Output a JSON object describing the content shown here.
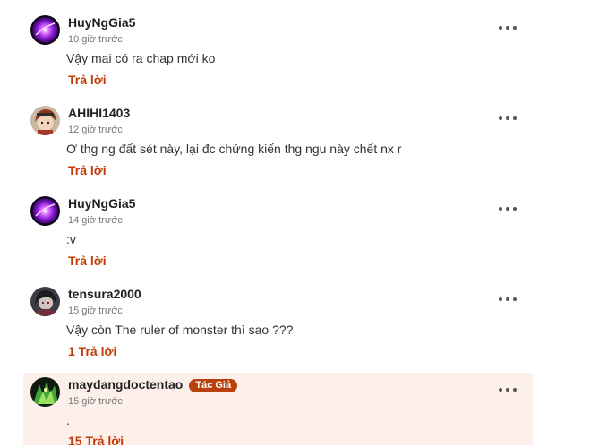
{
  "comments": [
    {
      "username": "HuyNgGia5",
      "time": "10 giờ trước",
      "content": "Vậy mai có ra chap mới ko",
      "reply_label": "Trả lời",
      "avatar": "purple-orb-avatar"
    },
    {
      "username": "AHIHI1403",
      "time": "12 giờ trước",
      "content": "Ơ thg ng đất sét này, lại đc chứng kiến thg ngu này chết nx r",
      "reply_label": "Trả lời",
      "avatar": "anime-character-avatar"
    },
    {
      "username": "HuyNgGia5",
      "time": "14 giờ trước",
      "content": ":v",
      "reply_label": "Trả lời",
      "avatar": "purple-orb-avatar"
    },
    {
      "username": "tensura2000",
      "time": "15 giờ trước",
      "content": "Vậy còn The ruler of monster thì sao ???",
      "reply_label": "1 Trả lời",
      "avatar": "dark-character-avatar"
    },
    {
      "username": "maydangdoctentao",
      "badge": "Tác Giả",
      "time": "15 giờ trước",
      "content": ".",
      "reply_label": "15 Trả lời",
      "avatar": "green-creature-avatar"
    }
  ],
  "colors": {
    "accent": "#c23b06",
    "badge_bg": "#b8400a",
    "highlight_bg": "#fdf0ea"
  },
  "icons": {
    "more": "more-horizontal-icon"
  }
}
